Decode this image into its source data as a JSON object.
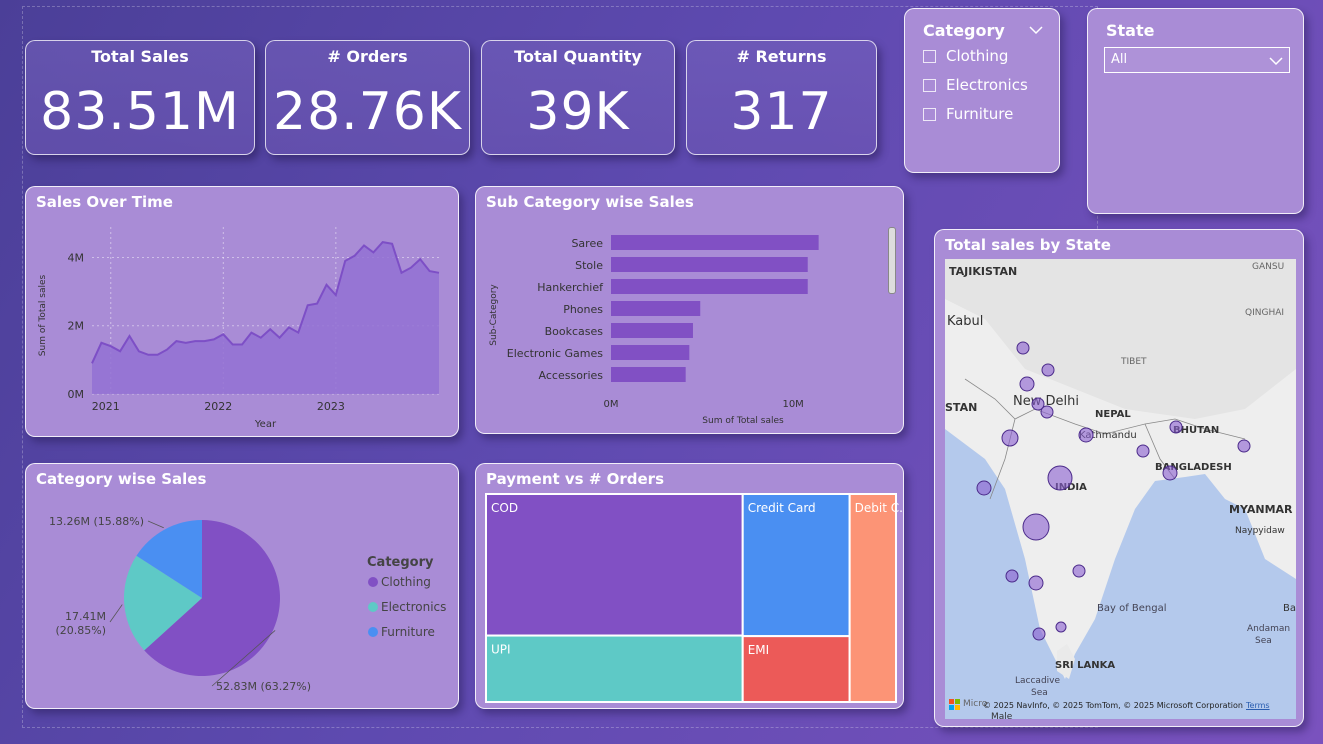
{
  "kpis": [
    {
      "title": "Total Sales",
      "value": "83.51M"
    },
    {
      "title": "# Orders",
      "value": "28.76K"
    },
    {
      "title": "Total Quantity",
      "value": "39K"
    },
    {
      "title": "# Returns",
      "value": "317"
    }
  ],
  "category_slicer": {
    "title": "Category",
    "options": [
      "Clothing",
      "Electronics",
      "Furniture"
    ]
  },
  "state_slicer": {
    "title": "State",
    "selected": "All"
  },
  "titles": {
    "sales_over_time": "Sales Over Time",
    "sub_category": "Sub Category wise Sales",
    "category": "Category wise Sales",
    "payment": "Payment vs # Orders",
    "map": "Total sales by State"
  },
  "map": {
    "labels": [
      "TAJIKISTAN",
      "GANSU",
      "Kabul",
      "QINGHAI",
      "TIBET",
      "STAN",
      "New Delhi",
      "NEPAL",
      "Kathmandu",
      "BHUTAN",
      "BANGLADESH",
      "INDIA",
      "MYANMAR",
      "Naypyidaw",
      "Bay of Bengal",
      "Andaman",
      "Sea",
      "SRI LANKA",
      "Laccadive",
      "Sea",
      "Male",
      "Ba"
    ],
    "copyright": "© 2025 NavInfo, © 2025 TomTom, © 2025 Microsoft Corporation",
    "terms": "Terms",
    "brand": "Micro"
  },
  "chart_data": [
    {
      "type": "area",
      "title": "Sales Over Time",
      "xlabel": "Year",
      "ylabel": "Sum of Total sales",
      "x_ticks": [
        "2021",
        "2022",
        "2023"
      ],
      "y_ticks": [
        "0M",
        "2M",
        "4M"
      ],
      "ylim": [
        0,
        4.6
      ],
      "x": [
        "2020-11",
        "2020-12",
        "2021-01",
        "2021-02",
        "2021-03",
        "2021-04",
        "2021-05",
        "2021-06",
        "2021-07",
        "2021-08",
        "2021-09",
        "2021-10",
        "2021-11",
        "2021-12",
        "2022-01",
        "2022-02",
        "2022-03",
        "2022-04",
        "2022-05",
        "2022-06",
        "2022-07",
        "2022-08",
        "2022-09",
        "2022-10",
        "2022-11",
        "2022-12",
        "2023-01",
        "2023-02",
        "2023-03",
        "2023-04",
        "2023-05",
        "2023-06",
        "2023-07",
        "2023-08",
        "2023-09",
        "2023-10",
        "2023-11",
        "2023-12"
      ],
      "series": [
        {
          "values": [
            0.9,
            1.5,
            1.4,
            1.25,
            1.7,
            1.25,
            1.15,
            1.15,
            1.3,
            1.55,
            1.5,
            1.55,
            1.55,
            1.6,
            1.75,
            1.45,
            1.45,
            1.8,
            1.65,
            1.9,
            1.65,
            1.95,
            1.8,
            2.6,
            2.65,
            3.2,
            2.9,
            3.9,
            4.05,
            4.35,
            4.15,
            4.45,
            4.4,
            3.55,
            3.7,
            3.95,
            3.6,
            3.55
          ]
        }
      ],
      "grid": true
    },
    {
      "type": "bar",
      "orientation": "horizontal",
      "title": "Sub Category wise Sales",
      "xlabel": "Sum of Total sales",
      "ylabel": "Sub-Category",
      "x_ticks": [
        "0M",
        "10M"
      ],
      "xlim": [
        0,
        14
      ],
      "categories": [
        "Saree",
        "Stole",
        "Hankerchief",
        "Phones",
        "Bookcases",
        "Electronic Games",
        "Accessories"
      ],
      "values": [
        11.4,
        10.8,
        10.8,
        4.9,
        4.5,
        4.3,
        4.1
      ]
    },
    {
      "type": "pie",
      "title": "Category wise Sales",
      "legend_title": "Category",
      "legend_position": "right",
      "categories": [
        "Clothing",
        "Electronics",
        "Furniture"
      ],
      "values": [
        52.83,
        17.41,
        13.26
      ],
      "percent": [
        63.27,
        20.85,
        15.88
      ],
      "labels": [
        "52.83M (63.27%)",
        "17.41M (20.85%)",
        "13.26M (15.88%)"
      ],
      "colors": [
        "#8150c4",
        "#5ec9c6",
        "#4a8ff2"
      ]
    },
    {
      "type": "treemap",
      "title": "Payment vs # Orders",
      "categories": [
        "COD",
        "UPI",
        "Credit Card",
        "EMI",
        "Debit Card"
      ],
      "labels": [
        "COD",
        "UPI",
        "Credit Card",
        "EMI",
        "Debit C..."
      ],
      "values": [
        9.8,
        4.6,
        4.1,
        1.9,
        2.6
      ],
      "colors": [
        "#8150c4",
        "#5ec9c6",
        "#4a8ff2",
        "#ec5a58",
        "#fc9476"
      ]
    }
  ],
  "colors": {
    "accent": "#8150c4",
    "card_bg": "#a98cd6",
    "bubble": "#8a5fd0"
  }
}
